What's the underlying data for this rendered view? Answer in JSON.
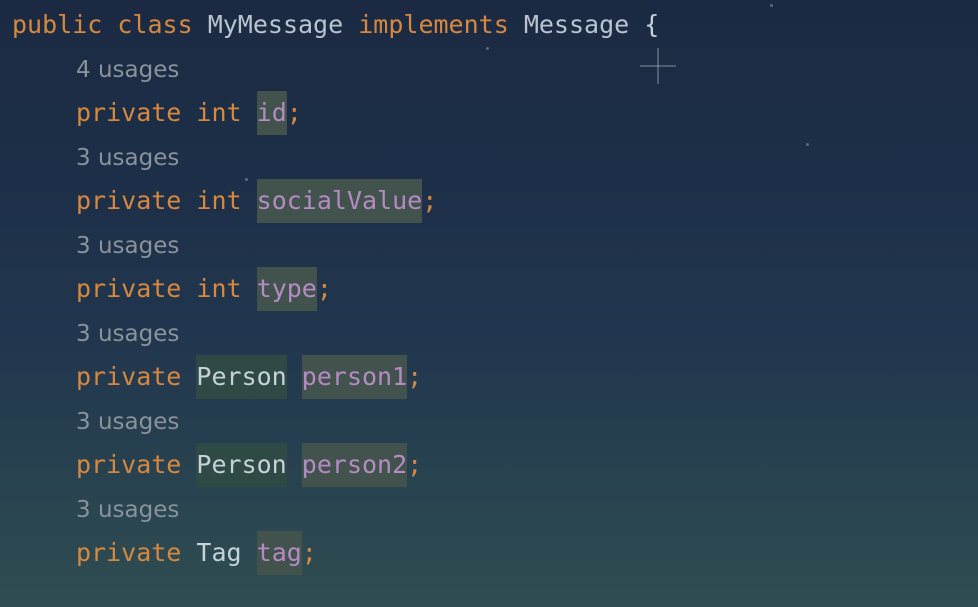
{
  "code": {
    "class_decl": {
      "kw_public": "public",
      "kw_class": "class",
      "class_name": "MyMessage",
      "kw_implements": "implements",
      "interface_name": "Message",
      "brace": "{"
    },
    "fields": [
      {
        "usages": "4 usages",
        "modifier": "private",
        "type": "int",
        "name": "id",
        "semi": ";"
      },
      {
        "usages": "3 usages",
        "modifier": "private",
        "type": "int",
        "name": "socialValue",
        "semi": ";"
      },
      {
        "usages": "3 usages",
        "modifier": "private",
        "type": "int",
        "name": "type",
        "semi": ";"
      },
      {
        "usages": "3 usages",
        "modifier": "private",
        "type": "Person",
        "name": "person1",
        "semi": ";"
      },
      {
        "usages": "3 usages",
        "modifier": "private",
        "type": "Person",
        "name": "person2",
        "semi": ";"
      },
      {
        "usages": "3 usages",
        "modifier": "private",
        "type": "Tag",
        "name": "tag",
        "semi": ";"
      }
    ]
  },
  "colors": {
    "keyword": "#d7883f",
    "field": "#b58bc4",
    "usages_hint": "#8a929b",
    "class_name": "#b9c4cf"
  }
}
